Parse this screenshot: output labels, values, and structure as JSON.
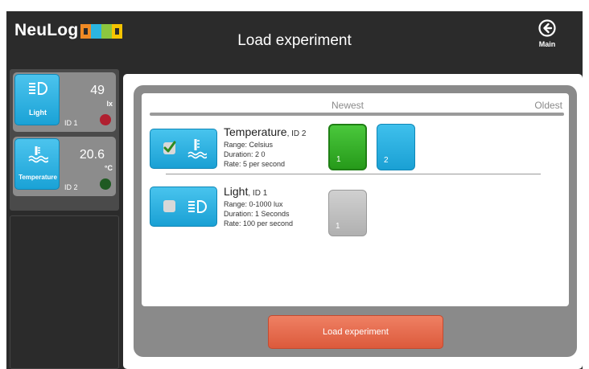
{
  "app": {
    "logo_text": "NeuLog"
  },
  "header": {
    "title": "Load experiment",
    "main_label": "Main"
  },
  "sensors": [
    {
      "name": "Light",
      "value": "49",
      "unit": "lx",
      "id_label": "ID 1",
      "led_color": "#b02030",
      "icon": "light-icon"
    },
    {
      "name": "Temperature",
      "value": "20.6",
      "unit": "°C",
      "id_label": "ID 2",
      "led_color": "#1f5a22",
      "icon": "thermometer-icon"
    }
  ],
  "experiments": {
    "newest_label": "Newest",
    "oldest_label": "Oldest",
    "rows": [
      {
        "name": "Temperature",
        "id_label": ", ID 2",
        "range": "Range: Celsius",
        "duration": "Duration: 2 0",
        "rate": "Rate: 5 per second",
        "checked": true,
        "icon": "thermometer-icon",
        "runs": [
          "1",
          "2"
        ]
      },
      {
        "name": "Light",
        "id_label": ", ID 1",
        "range": "Range: 0-1000 lux",
        "duration": "Duration: 1 Seconds",
        "rate": "Rate: 100 per second",
        "checked": false,
        "icon": "light-icon",
        "runs": [
          "1"
        ]
      }
    ]
  },
  "actions": {
    "load_label": "Load experiment"
  },
  "colors": {
    "accent_blue": "#1aa0d4",
    "selected_green": "#269a1a",
    "load_orange": "#dc5a3c",
    "background_dark": "#2b2b2b"
  }
}
